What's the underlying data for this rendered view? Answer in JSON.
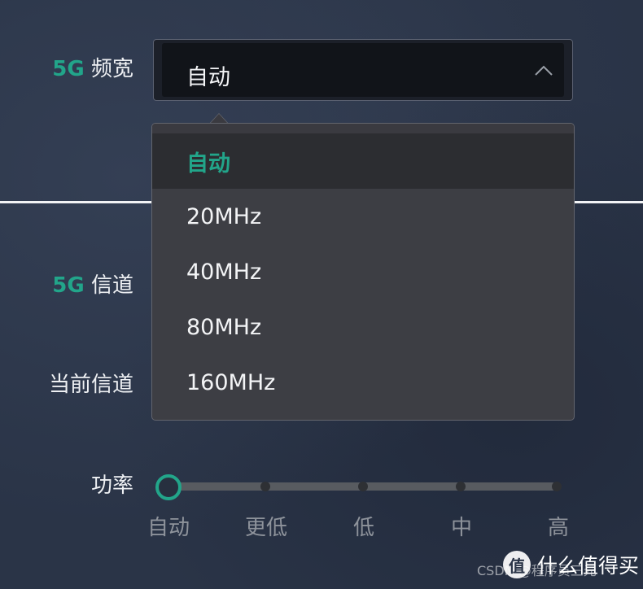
{
  "bandwidth": {
    "label_prefix": "5G",
    "label_text": " 频宽",
    "selected_value": "自动",
    "options": [
      "自动",
      "20MHz",
      "40MHz",
      "80MHz",
      "160MHz"
    ]
  },
  "channel": {
    "label_prefix": "5G",
    "label_text": " 信道"
  },
  "current_channel": {
    "label": "当前信道"
  },
  "power": {
    "label": "功率",
    "levels": [
      "自动",
      "更低",
      "低",
      "中",
      "高"
    ],
    "selected_index": 0
  },
  "watermark": {
    "csdn": "CSDN @程序员三元",
    "smzdm_logo": "值",
    "smzdm_text": "什么值得买"
  },
  "colors": {
    "accent": "#22a58a",
    "background": "#2a3447",
    "dropdown_bg": "#3d3e44"
  },
  "icons": {
    "chevron": "chevron-up-icon",
    "dropdown_caret": "caret-up-icon"
  }
}
